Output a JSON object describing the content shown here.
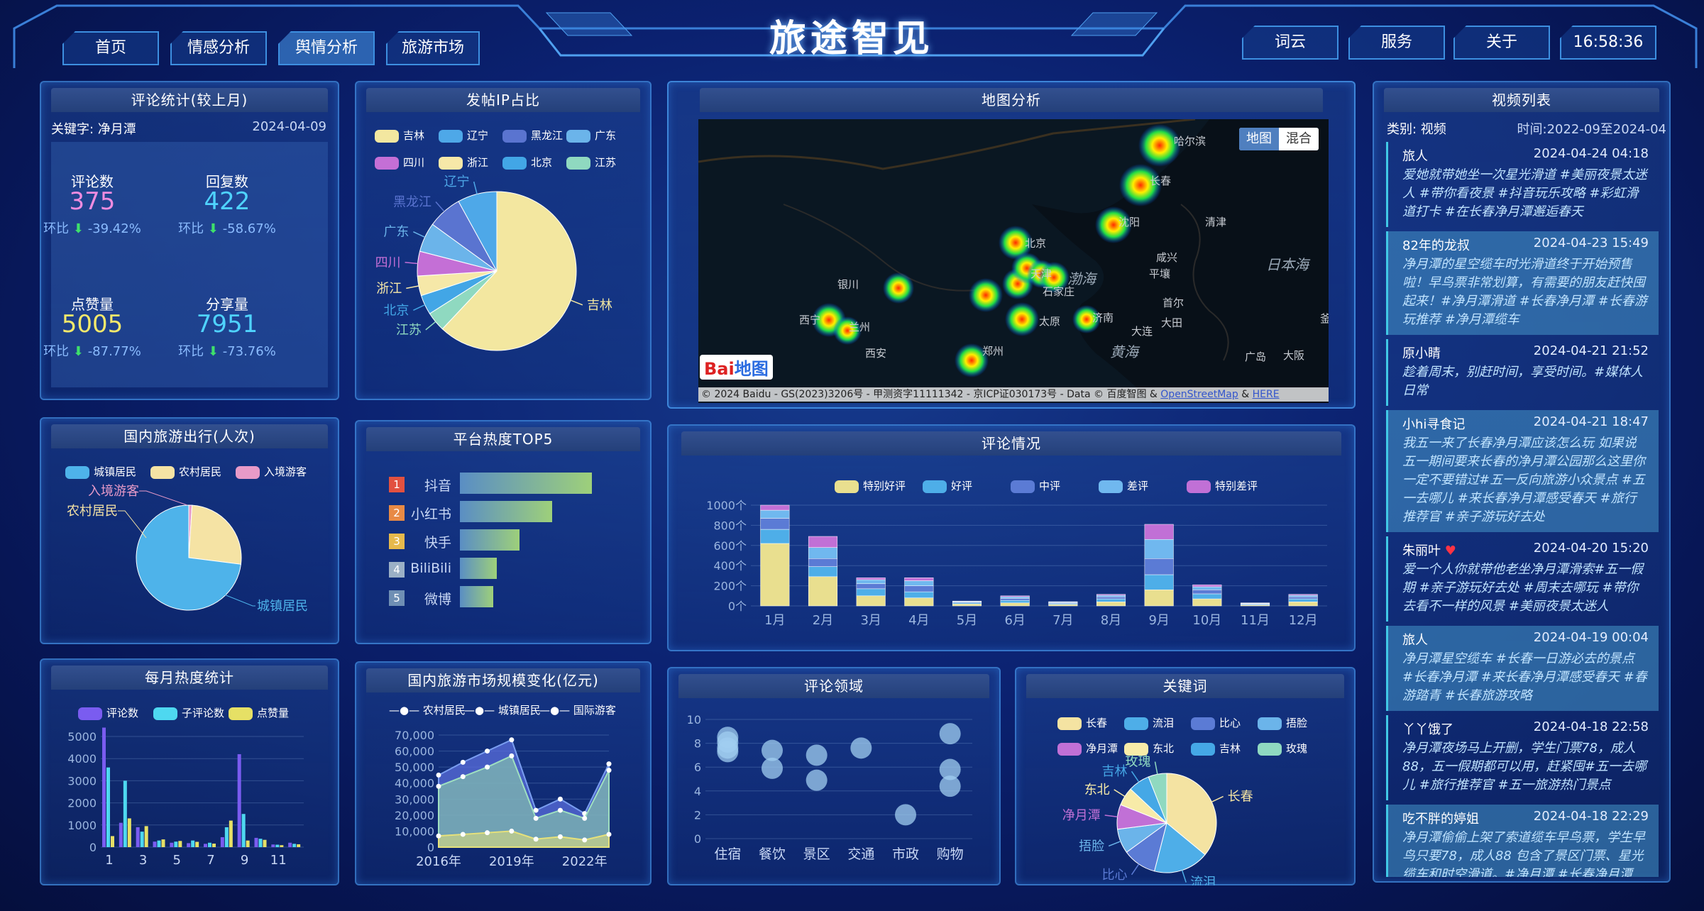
{
  "header": {
    "title": "旅途智见",
    "clock": "16:58:36"
  },
  "nav_left": [
    {
      "label": "首页"
    },
    {
      "label": "情感分析"
    },
    {
      "label": "舆情分析"
    },
    {
      "label": "旅游市场"
    }
  ],
  "nav_right": [
    {
      "label": "词云"
    },
    {
      "label": "服务"
    },
    {
      "label": "关于"
    }
  ],
  "stats": {
    "title": "评论统计(较上月)",
    "keyword": "关键字: 净月潭",
    "date": "2024-04-09",
    "huanbi": "环比",
    "items": [
      {
        "label": "评论数",
        "value": "375",
        "change": "-39.42%",
        "color": "#f08ce0"
      },
      {
        "label": "回复数",
        "value": "422",
        "change": "-58.67%",
        "color": "#4fd3ff"
      },
      {
        "label": "点赞量",
        "value": "5005",
        "change": "-87.77%",
        "color": "#f5e96b"
      },
      {
        "label": "分享量",
        "value": "7951",
        "change": "-73.76%",
        "color": "#4fd3ff"
      }
    ]
  },
  "ip": {
    "title": "发帖IP占比",
    "legend": [
      {
        "name": "吉林",
        "color": "#f3e7a0"
      },
      {
        "name": "辽宁",
        "color": "#4ea8e8"
      },
      {
        "name": "黑龙江",
        "color": "#5a74d0"
      },
      {
        "name": "广东",
        "color": "#6bb4ea"
      },
      {
        "name": "四川",
        "color": "#c46fd6"
      },
      {
        "name": "浙江",
        "color": "#f6e8a8"
      },
      {
        "name": "北京",
        "color": "#42a6e6"
      },
      {
        "name": "江苏",
        "color": "#8fd9c0"
      }
    ],
    "labels": [
      "江苏",
      "北京",
      "浙江",
      "四川",
      "广东",
      "黑龙江",
      "辽宁",
      "吉林"
    ]
  },
  "map": {
    "title": "地图分析",
    "btn_map": "地图",
    "btn_mix": "混合",
    "copyright": "© 2024 Baidu - GS(2023)3206号 - 甲测资字11111342 - 京ICP证030173号 - Data © 百度智图 & ",
    "osm": "OpenStreetMap",
    "amp": " & ",
    "here": "HERE",
    "logo": "Bai",
    "logo2": "地图",
    "places": [
      "北京",
      "渤海",
      "黄海",
      "日本海",
      "天津",
      "石家庄",
      "济南",
      "太原",
      "西安",
      "郑州",
      "银川",
      "兰州",
      "西宁",
      "大连",
      "平壤",
      "首尔",
      "清津",
      "咸兴",
      "大田",
      "广岛",
      "大阪",
      "釜山",
      "哈尔滨",
      "长春",
      "沈阳"
    ]
  },
  "videos": {
    "title": "视频列表",
    "category": "类别: 视频",
    "range": "时间:2022-09至2024-04",
    "items": [
      {
        "user": "旅人",
        "time": "2024-04-24 04:18",
        "text": "爱她就带她坐一次星光滑道 #美丽夜景太迷人 #带你看夜景 #抖音玩乐攻略 #彩虹滑道打卡 #在长春净月潭邂逅春天"
      },
      {
        "user": "82年的龙叔",
        "time": "2024-04-23 15:49",
        "text": "净月潭的星空缆车时光滑道终于开始预售啦！早鸟票非常划算，有需要的朋友赶快囤起来！#净月潭滑道 #长春净月潭 #长春游玩推荐 #净月潭缆车"
      },
      {
        "user": "原小睛",
        "time": "2024-04-21 21:52",
        "text": "趁着周末，别赶时间，享受时间。#媒体人日常"
      },
      {
        "user": "小hi寻食记",
        "time": "2024-04-21 18:47",
        "text": "我五一来了长春净月潭应该怎么玩 如果说五一期间要来长春的净月潭公园那么这里你一定不要错过#五一反向旅游小众景点 #五一去哪儿 #来长春净月潭感受春天 #旅行推荐官 #亲子游玩好去处"
      },
      {
        "user": "朱丽叶",
        "time": "2024-04-20 15:20",
        "text": "爱一个人你就带他老坐净月潭滑索#五一假期 #亲子游玩好去处 #周末去哪玩 #带你去看不一样的风景 #美丽夜景太迷人"
      },
      {
        "user": "旅人",
        "time": "2024-04-19 00:04",
        "text": "净月潭星空缆车 #长春一日游必去的景点 #长春净月潭 #来长春净月潭感受春天 #春游踏青 #长春旅游攻略"
      },
      {
        "user": "丫丫饿了",
        "time": "2024-04-18 22:58",
        "text": "净月潭夜场马上开删，学生门票78，成人88，五一假期都可以用，赶紧囤#五一去哪儿 #旅行推荐官 #五一旅游热门景点"
      },
      {
        "user": "吃不胖的婷姐",
        "time": "2024-04-18 22:29",
        "text": "净月潭偷偷上架了索道缆车早鸟票，学生早鸟只要78，成人88 包含了景区门票、星光缆车和时空滑道。#净月潭 #长春净月潭"
      }
    ]
  },
  "travel": {
    "title": "国内旅游出行(人次)",
    "legend": [
      {
        "name": "城镇居民",
        "color": "#4eb3ea"
      },
      {
        "name": "农村居民",
        "color": "#f5e3a4"
      },
      {
        "name": "入境游客",
        "color": "#e79ac8"
      }
    ],
    "labels": [
      "入境游客",
      "农村居民",
      "城镇居民"
    ]
  },
  "top5": {
    "title": "平台热度TOP5",
    "items": [
      {
        "rank": "1",
        "name": "抖音",
        "value": 100,
        "color": "#e25140"
      },
      {
        "rank": "2",
        "name": "小红书",
        "value": 70,
        "color": "#e88a45"
      },
      {
        "rank": "3",
        "name": "快手",
        "value": 45,
        "color": "#e6b94c"
      },
      {
        "rank": "4",
        "name": "BiliBili",
        "value": 28,
        "color": "#9bb0c6"
      },
      {
        "rank": "5",
        "name": "微博",
        "value": 25,
        "color": "#6f8fb4"
      }
    ]
  },
  "comments_chart": {
    "title": "评论情况",
    "legend": [
      {
        "name": "特别好评",
        "color": "#e9df8f"
      },
      {
        "name": "好评",
        "color": "#4eaee8"
      },
      {
        "name": "中评",
        "color": "#5b7bd5"
      },
      {
        "name": "差评",
        "color": "#70b8ef"
      },
      {
        "name": "特别差评",
        "color": "#c170d6"
      }
    ],
    "yticks": [
      "1000个",
      "800个",
      "600个",
      "400个",
      "200个",
      "0个"
    ]
  },
  "heat_chart": {
    "title": "每月热度统计",
    "legend": [
      {
        "name": "评论数",
        "color": "#7a5cf0"
      },
      {
        "name": "子评论数",
        "color": "#4ed8f0"
      },
      {
        "name": "点赞量",
        "color": "#e6e065"
      }
    ],
    "yticks": [
      "5000",
      "4000",
      "3000",
      "2000",
      "1000",
      "0"
    ]
  },
  "market": {
    "title": "国内旅游市场规模变化(亿元)",
    "legend": [
      "农村居民",
      "城镇居民",
      "国际游客"
    ],
    "yticks": [
      "70,000",
      "60,000",
      "50,000",
      "40,000",
      "30,000",
      "20,000",
      "10,000",
      "0"
    ]
  },
  "domain_chart": {
    "title": "评论领域",
    "yticks": [
      "10",
      "8",
      "6",
      "4",
      "2",
      "0"
    ]
  },
  "keywords": {
    "title": "关键词",
    "legend": [
      {
        "name": "长春",
        "color": "#f4e3a2"
      },
      {
        "name": "流泪",
        "color": "#4eaee8"
      },
      {
        "name": "比心",
        "color": "#5b7bd5"
      },
      {
        "name": "捂脸",
        "color": "#6bb4ea"
      },
      {
        "name": "净月潭",
        "color": "#c170d6"
      },
      {
        "name": "东北",
        "color": "#f7eba8"
      },
      {
        "name": "吉林",
        "color": "#45a8e6"
      },
      {
        "name": "玫瑰",
        "color": "#8fd9c0"
      }
    ],
    "labels": [
      "玫瑰",
      "吉林",
      "东北",
      "净月潭",
      "捂脸",
      "比心",
      "流泪",
      "长春"
    ]
  },
  "chart_data": [
    {
      "type": "pie",
      "title": "发帖IP占比",
      "categories": [
        "吉林",
        "辽宁",
        "黑龙江",
        "广东",
        "四川",
        "浙江",
        "北京",
        "江苏"
      ],
      "values": [
        62,
        8,
        7,
        6,
        5,
        4,
        4,
        4
      ]
    },
    {
      "type": "pie",
      "title": "国内旅游出行(人次)",
      "categories": [
        "城镇居民",
        "农村居民",
        "入境游客"
      ],
      "values": [
        73,
        26,
        1
      ]
    },
    {
      "type": "bar",
      "title": "平台热度TOP5",
      "categories": [
        "抖音",
        "小红书",
        "快手",
        "BiliBili",
        "微博"
      ],
      "values": [
        100,
        70,
        45,
        28,
        25
      ]
    },
    {
      "type": "bar",
      "title": "评论情况",
      "categories": [
        "1月",
        "2月",
        "3月",
        "4月",
        "5月",
        "6月",
        "7月",
        "8月",
        "9月",
        "10月",
        "11月",
        "12月"
      ],
      "ylim": [
        0,
        1000
      ],
      "series": [
        {
          "name": "特别好评",
          "values": [
            620,
            290,
            100,
            80,
            20,
            30,
            15,
            40,
            160,
            70,
            10,
            40
          ]
        },
        {
          "name": "好评",
          "values": [
            140,
            100,
            70,
            60,
            10,
            25,
            10,
            30,
            150,
            50,
            8,
            30
          ]
        },
        {
          "name": "中评",
          "values": [
            110,
            80,
            50,
            60,
            8,
            20,
            8,
            20,
            160,
            40,
            5,
            20
          ]
        },
        {
          "name": "差评",
          "values": [
            80,
            110,
            40,
            50,
            6,
            15,
            6,
            15,
            190,
            30,
            4,
            15
          ]
        },
        {
          "name": "特别差评",
          "values": [
            50,
            110,
            20,
            30,
            4,
            10,
            3,
            10,
            150,
            20,
            3,
            10
          ]
        }
      ]
    },
    {
      "type": "bar",
      "title": "每月热度统计",
      "categories": [
        "1",
        "2",
        "3",
        "4",
        "5",
        "6",
        "7",
        "8",
        "9",
        "10",
        "11",
        "12"
      ],
      "ylim": [
        0,
        5500
      ],
      "series": [
        {
          "name": "评论数",
          "values": [
            5400,
            1100,
            900,
            250,
            200,
            180,
            150,
            450,
            4200,
            420,
            120,
            200
          ]
        },
        {
          "name": "子评论数",
          "values": [
            3600,
            3000,
            700,
            300,
            250,
            300,
            200,
            900,
            1500,
            380,
            110,
            150
          ]
        },
        {
          "name": "点赞量",
          "values": [
            500,
            1300,
            950,
            350,
            280,
            240,
            160,
            1200,
            300,
            330,
            90,
            130
          ]
        }
      ]
    },
    {
      "type": "area",
      "title": "国内旅游市场规模变化(亿元)",
      "x": [
        "2016年",
        "2017年",
        "2018年",
        "2019年",
        "2020年",
        "2021年",
        "2022年",
        "2023年"
      ],
      "ylim": [
        0,
        70000
      ],
      "series": [
        {
          "name": "农村居民",
          "values": [
            7000,
            8000,
            9000,
            10000,
            5000,
            6500,
            4500,
            8000
          ]
        },
        {
          "name": "城镇居民",
          "values": [
            38000,
            44000,
            50000,
            57000,
            18000,
            23000,
            18000,
            48000
          ]
        },
        {
          "name": "国际游客",
          "values": [
            45000,
            53000,
            60000,
            67000,
            23000,
            30000,
            21000,
            52000
          ]
        }
      ]
    },
    {
      "type": "scatter",
      "title": "评论领域",
      "categories": [
        "住宿",
        "餐饮",
        "景区",
        "交通",
        "市政",
        "购物"
      ],
      "ylim": [
        0,
        10
      ],
      "series": [
        {
          "name": "评论领域",
          "values": [
            [
              0,
              8.5
            ],
            [
              0,
              8.1
            ],
            [
              0,
              7.6
            ],
            [
              0,
              7.3
            ],
            [
              1,
              7.4
            ],
            [
              1,
              5.9
            ],
            [
              2,
              7.0
            ],
            [
              2,
              4.9
            ],
            [
              3,
              7.6
            ],
            [
              4,
              2.0
            ],
            [
              5,
              8.8
            ],
            [
              5,
              5.8
            ],
            [
              5,
              4.4
            ]
          ]
        }
      ]
    },
    {
      "type": "pie",
      "title": "关键词",
      "categories": [
        "长春",
        "流泪",
        "比心",
        "捂脸",
        "净月潭",
        "东北",
        "吉林",
        "玫瑰"
      ],
      "values": [
        36,
        18,
        11,
        8,
        8,
        6,
        7,
        6
      ]
    }
  ]
}
